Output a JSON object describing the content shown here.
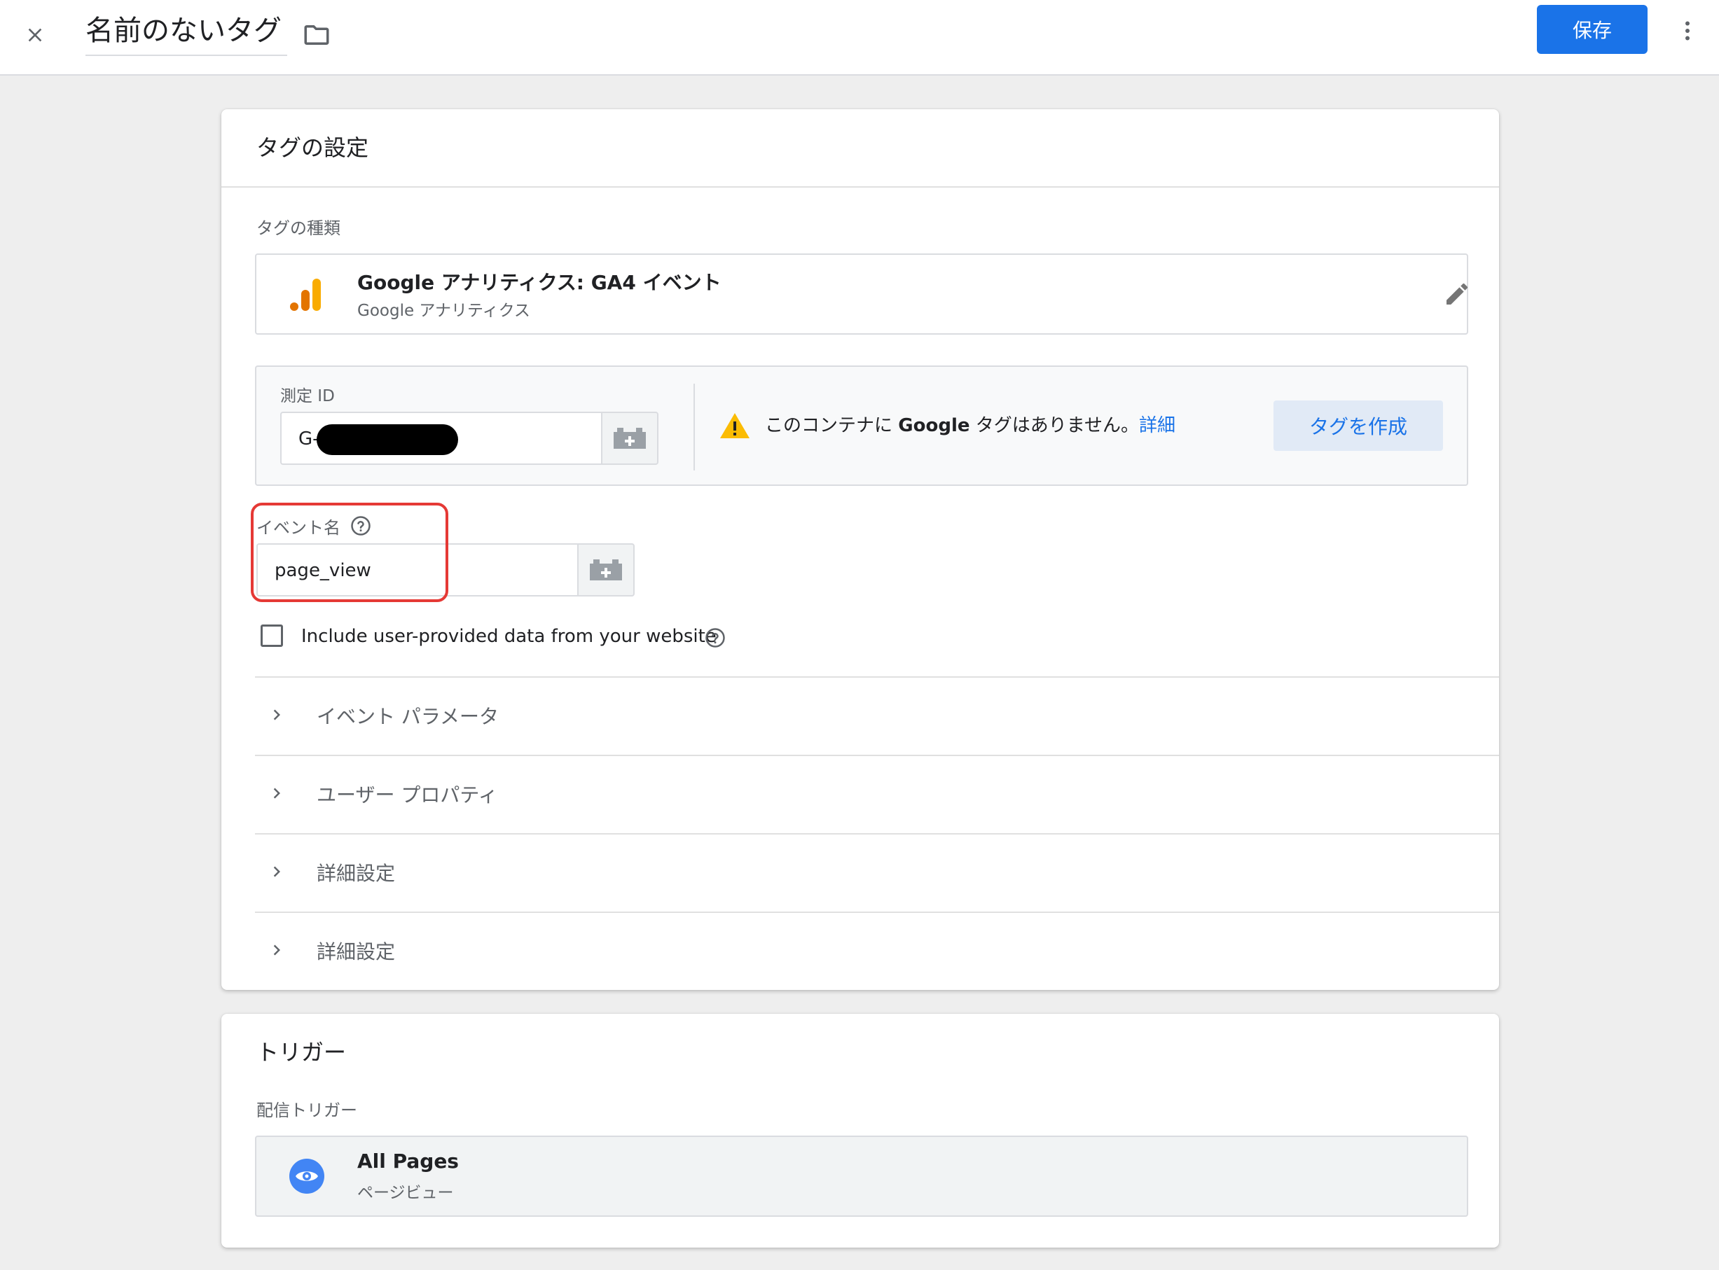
{
  "header": {
    "title": "名前のないタグ",
    "save_label": "保存"
  },
  "tag_config": {
    "title": "タグの設定",
    "tag_type_label": "タグの種類",
    "tag_type": {
      "name": "Google アナリティクス: GA4 イベント",
      "sub": "Google アナリティクス",
      "icon": "analytics-bars-icon"
    },
    "measurement_id": {
      "label": "測定 ID",
      "value_prefix": "G-",
      "warning_text": "このコンテナに",
      "warning_bold": "Google",
      "warning_text_after": "タグはありません。",
      "warning_link": "詳細",
      "create_button": "タグを作成"
    },
    "event_name": {
      "label": "イベント名",
      "value": "page_view"
    },
    "checkbox_label": "Include user-provided data from your website",
    "sections": [
      {
        "label": "イベント パラメータ"
      },
      {
        "label": "ユーザー プロパティ"
      },
      {
        "label": "詳細設定"
      },
      {
        "label": "詳細設定"
      }
    ]
  },
  "trigger": {
    "title": "トリガー",
    "firing_label": "配信トリガー",
    "item": {
      "name": "All Pages",
      "sub": "ページビュー",
      "icon": "eye-icon"
    }
  },
  "colors": {
    "primary": "#1a73e8",
    "warning": "#fbbc04",
    "highlight": "#e53935",
    "analytics_orange": "#f9ab00"
  }
}
